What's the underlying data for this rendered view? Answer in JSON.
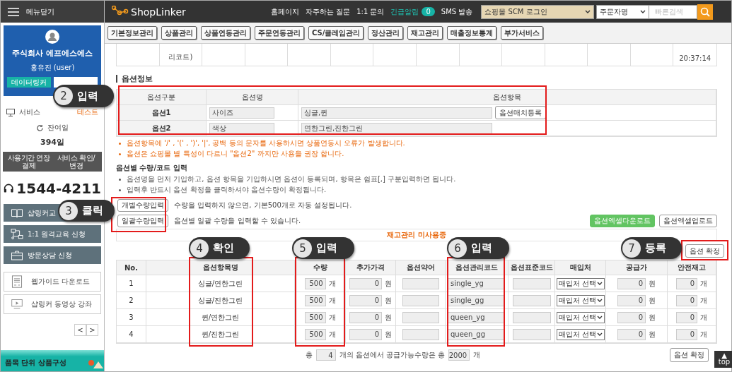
{
  "sidebar": {
    "menu_toggle": "메뉴닫기",
    "company": "주식회사 에프에스에스",
    "user": "홍유진 (user)",
    "profile_button": "데이터링커",
    "service": {
      "label": "서비스",
      "status": "테스트"
    },
    "remaining": {
      "label": "잔여일",
      "value": "394일"
    },
    "service_buttons": [
      "사용기간 연장결제",
      "서비스 확인/변경"
    ],
    "phone": "1544-4211",
    "menu_items": [
      {
        "label": "샵링커교",
        "kind": "book"
      },
      {
        "label": "1:1 원격교육 신청",
        "kind": "network"
      },
      {
        "label": "방문상담 신청",
        "kind": "briefcase"
      }
    ],
    "link_buttons": [
      {
        "label": "웹가이드 다운로드",
        "kind": "document"
      },
      {
        "label": "샵링커 동영상 강좌",
        "kind": "video"
      }
    ],
    "pager": [
      "<",
      ">"
    ],
    "banner": "품목 단위 상품구성"
  },
  "header": {
    "logo": "ShopLinker",
    "links": [
      {
        "label": "홈페이지"
      },
      {
        "label": "자주하는 질문"
      },
      {
        "label": "1:1 문의"
      },
      {
        "label": "긴급알림",
        "badge": "0"
      },
      {
        "label": "SMS 발송"
      }
    ],
    "mall_select": "쇼핑몰 SCM 로그인",
    "search_type": "주문자명",
    "search": {
      "placeholder": "빠른검색"
    }
  },
  "nav": [
    "기본정보관리",
    "상품관리",
    "상품연동관리",
    "주문연동관리",
    "CS/클레임관리",
    "정산관리",
    "재고관리",
    "매출정보통계",
    "부가서비스"
  ],
  "partial_row": {
    "column_2": "리코드)",
    "column_14": "20:37:14"
  },
  "option_info": {
    "title": "옵션정보",
    "columns": [
      "옵션구분",
      "옵션명",
      "옵션항목"
    ],
    "rows": [
      {
        "label": "옵션1",
        "name": "사이즈",
        "items": "싱글,퀸",
        "button": "옵션매치등록"
      },
      {
        "label": "옵션2",
        "name": "색상",
        "items": "연한그린,진한그린"
      }
    ],
    "warnings": [
      "옵션항목에 '/' , '(' , ')', '|', 공백 등의 문자를 사용하시면 상품연동시 오류가 발생합니다.",
      "옵션은 쇼핑몰 별 특성이 다르니 \"옵션2\" 까지만 사용을 권장 합니다."
    ]
  },
  "qty_section": {
    "title": "옵션별 수량/코드 입력",
    "notes": [
      "옵션명을 먼저 기입하고, 옵션 항목을 기입하시면 옵션이 등록되며, 항목은 쉼표[,] 구분입력하면 됩니다.",
      "입력후 반드시 옵션 확정을 클릭하셔야 옵션수량이 확정됩니다."
    ],
    "actions": [
      {
        "button": "개별수량입력",
        "text": "수량을 입력하지 않으면, 기본500개로 자동 설정됩니다."
      },
      {
        "button": "일괄수량입력",
        "text": "옵션별 일괄 수량을 입력할 수 있습니다."
      }
    ],
    "excel_buttons": [
      {
        "label": "옵션엑셀다운로드",
        "kind": "green"
      },
      {
        "label": "옵션엑셀업로드",
        "kind": "plain"
      }
    ],
    "stock_notice": "재고관리 미사용중",
    "confirm_button": "옵션 확정"
  },
  "grid": {
    "columns": [
      "No.",
      "옵션항목명",
      "수량",
      "추가가격",
      "옵션약어",
      "옵션관리코드",
      "옵션표준코드",
      "매입처",
      "공급가",
      "안전재고"
    ],
    "rows": [
      {
        "no": "1",
        "name": "싱글/연한그린",
        "qty": "500",
        "qty_unit": "개",
        "price": "0",
        "price_unit": "원",
        "code": "single_yg",
        "supplier": "매입처 선택",
        "supply_price": "0",
        "supply_unit": "원",
        "safety_stock": "0",
        "safety_unit": "개"
      },
      {
        "no": "2",
        "name": "싱글/진한그린",
        "qty": "500",
        "qty_unit": "개",
        "price": "0",
        "price_unit": "원",
        "code": "single_gg",
        "supplier": "매입처 선택",
        "supply_price": "0",
        "supply_unit": "원",
        "safety_stock": "0",
        "safety_unit": "개"
      },
      {
        "no": "3",
        "name": "퀸/연한그린",
        "qty": "500",
        "qty_unit": "개",
        "price": "0",
        "price_unit": "원",
        "code": "queen_yg",
        "supplier": "매입처 선택",
        "supply_price": "0",
        "supply_unit": "원",
        "safety_stock": "0",
        "safety_unit": "개"
      },
      {
        "no": "4",
        "name": "퀸/진한그린",
        "qty": "500",
        "qty_unit": "개",
        "price": "0",
        "price_unit": "원",
        "code": "queen_gg",
        "supplier": "매입처 선택",
        "supply_price": "0",
        "supply_unit": "원",
        "safety_stock": "0",
        "safety_unit": "개"
      }
    ]
  },
  "footer": {
    "prefix": "총",
    "count": "4",
    "middle": "개의 옵션에서 공급가능수량은 총",
    "total": "2000",
    "suffix": "개",
    "button": "옵션 확정"
  },
  "top_button": {
    "arrow": "▲",
    "label": "top"
  },
  "annotations": [
    {
      "number": "2",
      "label": "입력"
    },
    {
      "number": "3",
      "label": "클릭"
    },
    {
      "number": "4",
      "label": "확인"
    },
    {
      "number": "5",
      "label": "입력"
    },
    {
      "number": "6",
      "label": "입력"
    },
    {
      "number": "7",
      "label": "등록"
    }
  ]
}
